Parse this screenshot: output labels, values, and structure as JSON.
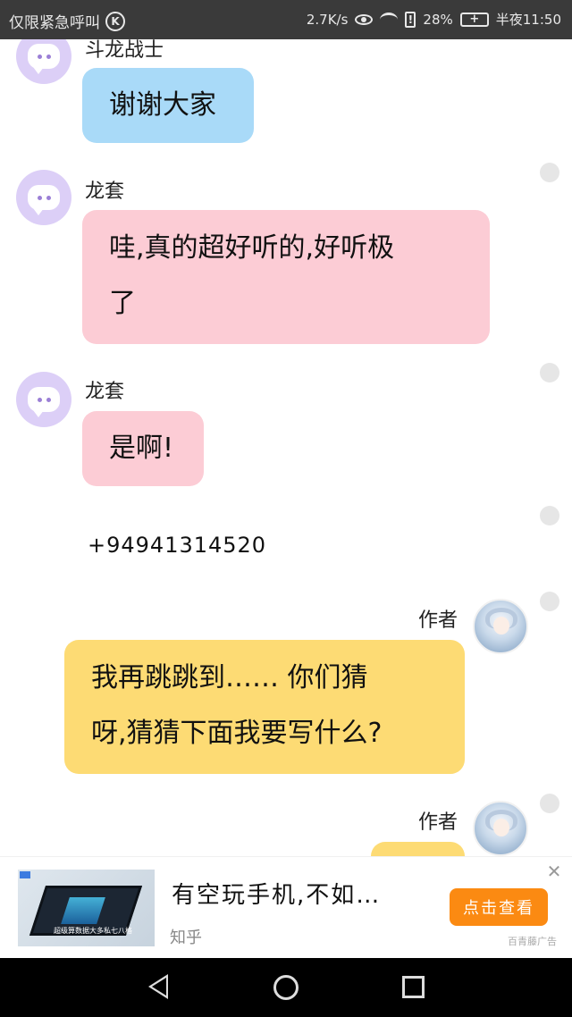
{
  "status_bar": {
    "carrier": "仅限紧急呼叫",
    "k_badge": "K",
    "speed": "2.7K/s",
    "battery": "28%",
    "time": "半夜11:50",
    "icons": [
      "eye-icon",
      "wifi-icon",
      "alert-icon",
      "battery-icon"
    ]
  },
  "chat": {
    "messages": [
      {
        "sender": "斗龙战士",
        "text": "谢谢大家",
        "style": "blue",
        "side": "left"
      },
      {
        "sender": "龙套",
        "text": "哇,真的超好听的,好听极了",
        "line1": "哇,真的超好听的,好听极",
        "line2": "了",
        "style": "pink",
        "side": "left"
      },
      {
        "sender": "龙套",
        "text": "是啊!",
        "style": "pink",
        "side": "left"
      },
      {
        "sender": "",
        "text": "+94941314520",
        "style": "plain",
        "side": "left"
      },
      {
        "sender": "作者",
        "line1": "我再跳跳到…… 你们猜",
        "line2": "呀,猜猜下面我要写什么?",
        "style": "yellow",
        "side": "right"
      },
      {
        "sender": "作者",
        "text": "",
        "style": "yellow",
        "side": "right"
      }
    ]
  },
  "ad": {
    "title": "有空玩手机,不如…",
    "source": "知乎",
    "cta": "点击查看",
    "close": "✕",
    "label": "百青藤广告",
    "image_caption": "超级算数据大多私七八格"
  },
  "colors": {
    "blue_bubble": "#a9daf8",
    "pink_bubble": "#fcccd5",
    "yellow_bubble": "#fddb74",
    "avatar": "#dccff7",
    "cta": "#fb8a12"
  }
}
